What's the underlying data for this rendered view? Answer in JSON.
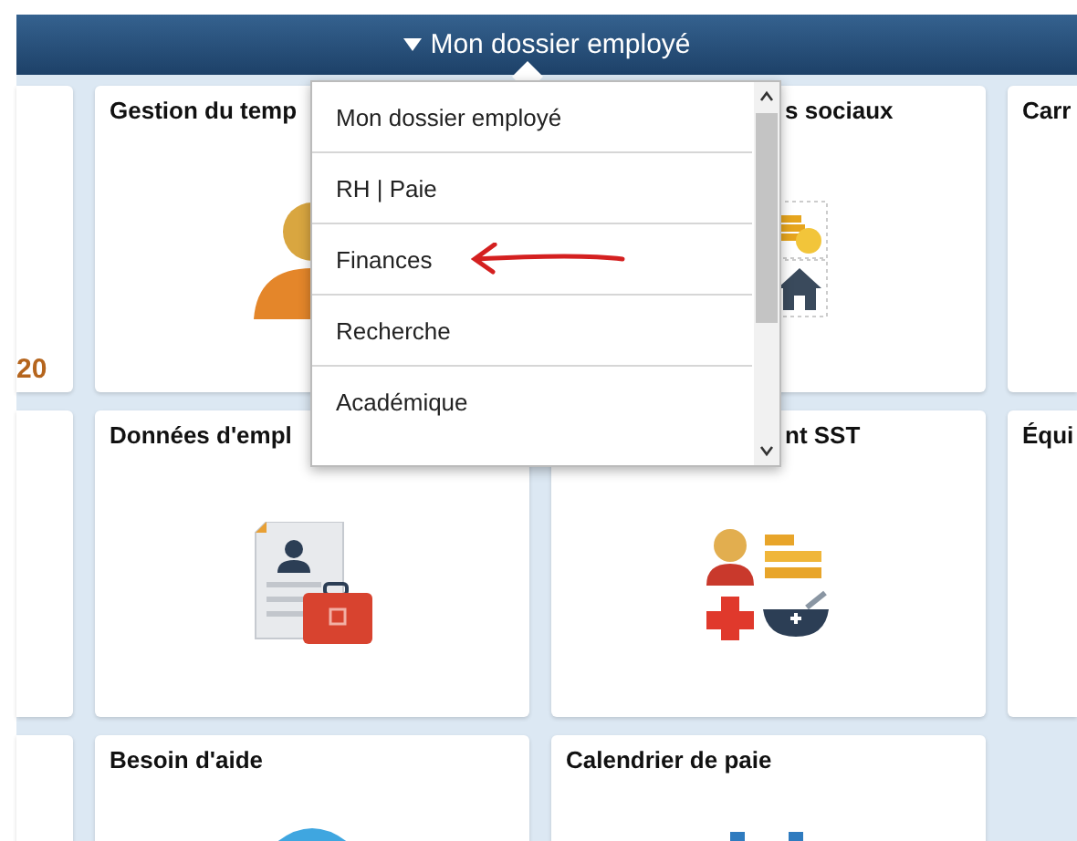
{
  "header": {
    "title": "Mon dossier employé"
  },
  "tiles": [
    {
      "value": "20",
      "kind": "blank"
    },
    {
      "title": "Gestion du temp",
      "kind": "person"
    },
    {
      "title": "s sociaux",
      "kind": "benefits"
    },
    {
      "title": "Carr",
      "kind": "blank"
    },
    {
      "kind": "blank"
    },
    {
      "title": "Données d'empl",
      "kind": "employee-file"
    },
    {
      "title": "nt SST",
      "kind": "health"
    },
    {
      "title": "Équi",
      "kind": "blank"
    },
    {
      "kind": "blank"
    },
    {
      "title": "Besoin d'aide",
      "kind": "help"
    },
    {
      "title": "Calendrier de paie",
      "kind": "calendar"
    }
  ],
  "dropdown": {
    "items": [
      {
        "label": "Mon dossier employé",
        "pointed": false
      },
      {
        "label": "RH | Paie",
        "pointed": false
      },
      {
        "label": "Finances",
        "pointed": true
      },
      {
        "label": "Recherche",
        "pointed": false
      },
      {
        "label": "Académique",
        "pointed": false
      }
    ]
  }
}
